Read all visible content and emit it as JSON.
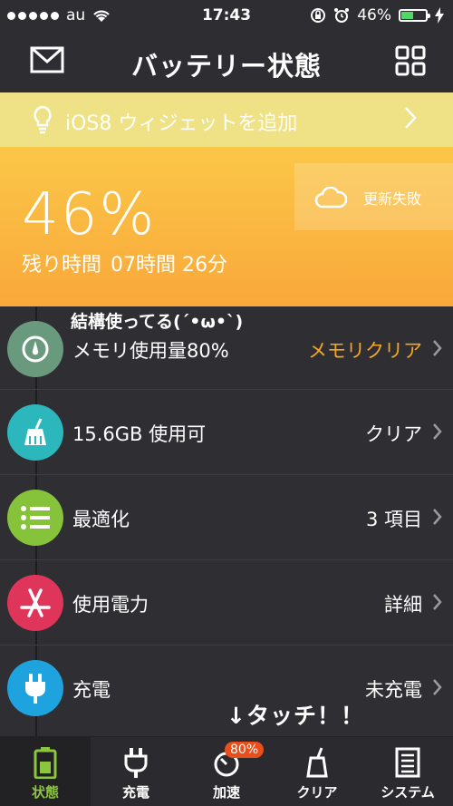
{
  "status_bar": {
    "carrier": "au",
    "time": "17:43",
    "battery_pct": "46%"
  },
  "nav": {
    "title": "バッテリー状態"
  },
  "banner": {
    "label": "iOS8 ウィジェットを追加"
  },
  "battery": {
    "percent": "46%",
    "remain_label": "残り時間",
    "remain_value": "07時間 26分",
    "update_status": "更新失敗"
  },
  "rows": [
    {
      "note": "結構使ってる(´•ω•`)",
      "label": "メモリ使用量80%",
      "action": "メモリクリア",
      "color": "#6a9a7e"
    },
    {
      "label": "15.6GB 使用可",
      "action": "クリア",
      "color": "#2cb7bd"
    },
    {
      "label": "最適化",
      "action": "3 項目",
      "color": "#86c23a"
    },
    {
      "label": "使用電力",
      "action": "詳細",
      "color": "#e0355b"
    },
    {
      "label": "充電",
      "action": "未充電",
      "color": "#1fa3de"
    }
  ],
  "annotation": "↓タッチ！！",
  "tabs": [
    {
      "label": "状態"
    },
    {
      "label": "充電"
    },
    {
      "label": "加速",
      "badge": "80%"
    },
    {
      "label": "クリア"
    },
    {
      "label": "システム"
    }
  ],
  "colors": {
    "accent_orange": "#f5a623",
    "accent_green": "#8cc63e",
    "badge_red": "#e94e1b"
  }
}
